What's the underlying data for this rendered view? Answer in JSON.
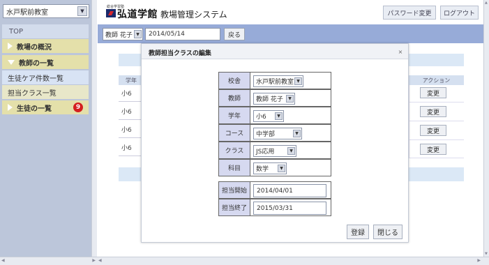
{
  "sidebar": {
    "school_select": "水戸駅前教室",
    "top": "TOP",
    "items": [
      {
        "label": "教場の概況"
      },
      {
        "label": "教師の一覧"
      },
      {
        "label": "生徒ケア件数一覧"
      },
      {
        "label": "担当クラス一覧"
      },
      {
        "label": "生徒の一覧",
        "badge": "9"
      }
    ]
  },
  "header": {
    "logo_sub": "総合学習塾",
    "logo_text": "弘道学館",
    "system_title": "教場管理システム",
    "password_button": "パスワード変更",
    "logout_button": "ログアウト"
  },
  "toolbar": {
    "teacher": "教師 花子",
    "date": "2014/05/14",
    "back": "戻る"
  },
  "background_table": {
    "header_left": "学年",
    "header_action": "アクション",
    "rows": [
      {
        "grade": "小6",
        "action": "変更"
      },
      {
        "grade": "小6",
        "action": "変更"
      },
      {
        "grade": "小6",
        "action": "変更"
      },
      {
        "grade": "小6",
        "action": "変更"
      }
    ]
  },
  "modal": {
    "title": "教師担当クラスの編集",
    "close": "×",
    "fields": [
      {
        "label": "校舎",
        "value": "水戸駅前教室",
        "type": "select"
      },
      {
        "label": "教師",
        "value": "教師 花子",
        "type": "select"
      },
      {
        "label": "学年",
        "value": "小6",
        "type": "select"
      },
      {
        "label": "コース",
        "value": "中学部",
        "type": "select"
      },
      {
        "label": "クラス",
        "value": "JS応用",
        "type": "select"
      },
      {
        "label": "科目",
        "value": "数学",
        "type": "select"
      },
      {
        "label": "担当開始",
        "value": "2014/04/01",
        "type": "input"
      },
      {
        "label": "担当終了",
        "value": "2015/03/31",
        "type": "input"
      }
    ],
    "register_button": "登録",
    "close_button": "閉じる"
  },
  "icons": {
    "dropdown": "▼",
    "scroll_up": "▲",
    "scroll_down": "▼",
    "scroll_left": "◀",
    "scroll_right": "▶"
  },
  "colors": {
    "toolbar": "#97abd8",
    "sidebar": "#bcc6da",
    "category": "#e4e0aa",
    "badge": "#d41f1f"
  }
}
